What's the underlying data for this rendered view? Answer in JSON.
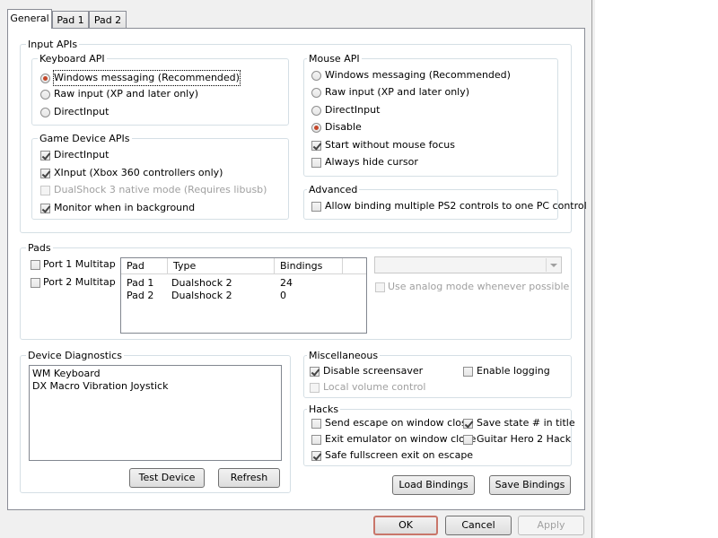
{
  "tabs": [
    "General",
    "Pad 1",
    "Pad 2"
  ],
  "input_apis": {
    "label": "Input APIs",
    "keyboard": {
      "label": "Keyboard API",
      "options": [
        "Windows messaging (Recommended)",
        "Raw input (XP and later only)",
        "DirectInput"
      ],
      "selected": 0
    },
    "game_device": {
      "label": "Game Device APIs",
      "options": [
        {
          "label": "DirectInput",
          "checked": true,
          "enabled": true
        },
        {
          "label": "XInput (Xbox 360 controllers only)",
          "checked": true,
          "enabled": true
        },
        {
          "label": "DualShock 3 native mode (Requires libusb)",
          "checked": false,
          "enabled": false
        },
        {
          "label": "Monitor when in background",
          "checked": true,
          "enabled": true
        }
      ]
    },
    "mouse": {
      "label": "Mouse API",
      "options": [
        "Windows messaging (Recommended)",
        "Raw input (XP and later only)",
        "DirectInput",
        "Disable"
      ],
      "selected": 3,
      "start_without_focus": {
        "label": "Start without mouse focus",
        "checked": true
      },
      "always_hide_cursor": {
        "label": "Always hide cursor",
        "checked": false
      }
    },
    "advanced": {
      "label": "Advanced",
      "allow_binding": {
        "label": "Allow binding multiple PS2 controls to one PC control",
        "checked": false
      }
    }
  },
  "pads": {
    "label": "Pads",
    "port1": {
      "label": "Port 1 Multitap",
      "checked": false
    },
    "port2": {
      "label": "Port 2 Multitap",
      "checked": false
    },
    "columns": [
      "Pad",
      "Type",
      "Bindings"
    ],
    "rows": [
      [
        "Pad 1",
        "Dualshock 2",
        "24"
      ],
      [
        "Pad 2",
        "Dualshock 2",
        "0"
      ]
    ],
    "analog": {
      "label": "Use analog mode whenever possible",
      "checked": false
    }
  },
  "diagnostics": {
    "label": "Device Diagnostics",
    "devices": [
      "WM Keyboard",
      "DX Macro Vibration Joystick"
    ],
    "test_label": "Test Device",
    "refresh_label": "Refresh"
  },
  "misc": {
    "label": "Miscellaneous",
    "disable_screensaver": {
      "label": "Disable screensaver",
      "checked": true
    },
    "enable_logging": {
      "label": "Enable logging",
      "checked": false
    },
    "local_volume": {
      "label": "Local volume control",
      "checked": false
    }
  },
  "hacks": {
    "label": "Hacks",
    "send_escape": {
      "label": "Send escape on window close",
      "checked": false
    },
    "save_state": {
      "label": "Save state # in title",
      "checked": true
    },
    "exit_emulator": {
      "label": "Exit emulator on window close",
      "checked": false
    },
    "guitar_hero": {
      "label": "Guitar Hero 2 Hack",
      "checked": false
    },
    "safe_fullscreen": {
      "label": "Safe fullscreen exit on escape",
      "checked": true
    }
  },
  "bindings": {
    "load": "Load Bindings",
    "save": "Save Bindings"
  },
  "footer": {
    "ok": "OK",
    "cancel": "Cancel",
    "apply": "Apply"
  }
}
